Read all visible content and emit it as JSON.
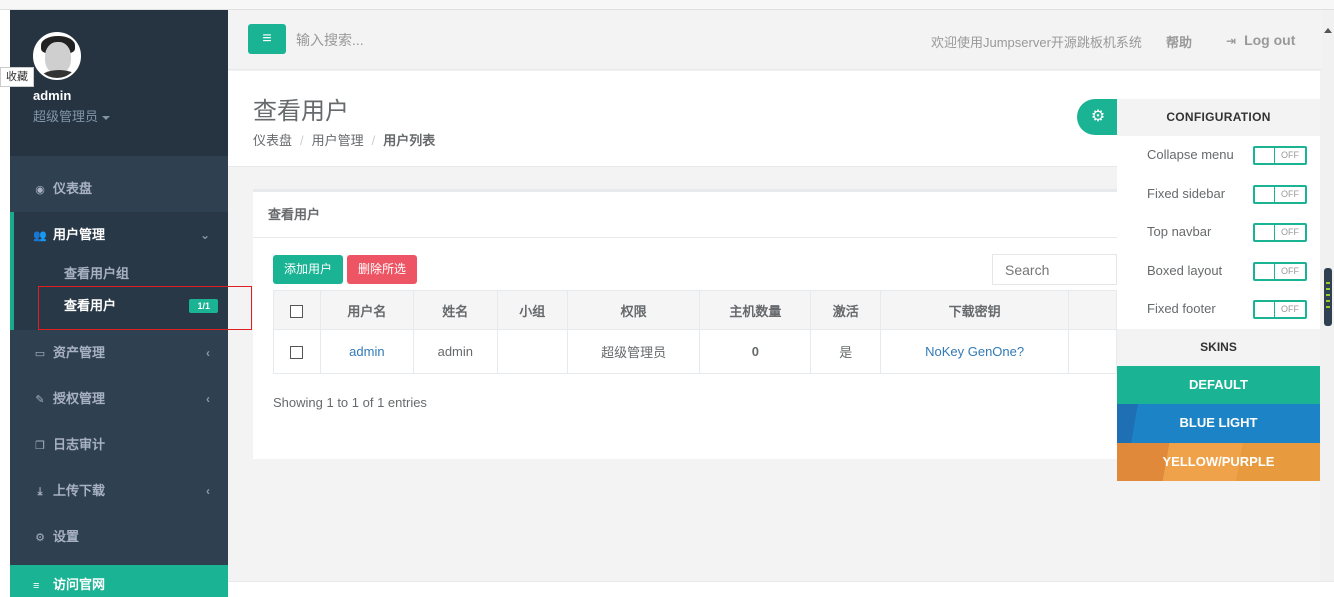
{
  "sidebar": {
    "collect_tag": "收藏",
    "user": {
      "name": "admin",
      "role": "超级管理员"
    },
    "items": [
      {
        "label": "仪表盘",
        "icon": "dashboard-icon"
      },
      {
        "label": "用户管理",
        "icon": "users-icon",
        "expanded": true
      },
      {
        "label": "资产管理",
        "icon": "hdd-icon"
      },
      {
        "label": "授权管理",
        "icon": "edit-icon"
      },
      {
        "label": "日志审计",
        "icon": "copy-icon"
      },
      {
        "label": "上传下载",
        "icon": "download-icon"
      },
      {
        "label": "设置",
        "icon": "cogs-icon"
      },
      {
        "label": "访问官网",
        "icon": "database-icon"
      }
    ],
    "subitems": [
      {
        "label": "查看用户组"
      },
      {
        "label": "查看用户",
        "badge": "1/1"
      }
    ]
  },
  "topbar": {
    "search_placeholder": "输入搜索...",
    "welcome": "欢迎使用Jumpserver开源跳板机系统",
    "help": "帮助",
    "logout": "Log out"
  },
  "page": {
    "title": "查看用户",
    "breadcrumb": [
      "仪表盘",
      "用户管理",
      "用户列表"
    ]
  },
  "panel": {
    "title": "查看用户",
    "add_button": "添加用户",
    "delete_button": "删除所选",
    "search_placeholder": "Search",
    "columns": [
      "用户名",
      "姓名",
      "小组",
      "权限",
      "主机数量",
      "激活",
      "下载密钥",
      ""
    ],
    "rows": [
      {
        "username": "admin",
        "name": "admin",
        "group": "",
        "role": "超级管理员",
        "hosts": "0",
        "active": "是",
        "key": "NoKey GenOne?"
      }
    ],
    "showing": "Showing 1 to 1 of 1 entries"
  },
  "config": {
    "title": "CONFIGURATION",
    "options": [
      {
        "label": "Collapse menu",
        "state": "OFF"
      },
      {
        "label": "Fixed sidebar",
        "state": "OFF"
      },
      {
        "label": "Top navbar",
        "state": "OFF"
      },
      {
        "label": "Boxed layout",
        "state": "OFF"
      },
      {
        "label": "Fixed footer",
        "state": "OFF"
      }
    ],
    "skins_title": "SKINS",
    "skins": [
      "DEFAULT",
      "BLUE LIGHT",
      "YELLOW/PURPLE"
    ]
  },
  "colors": {
    "accent": "#1ab394",
    "sidebar": "#2f4050",
    "danger": "#ed5565",
    "link": "#337ab7"
  }
}
